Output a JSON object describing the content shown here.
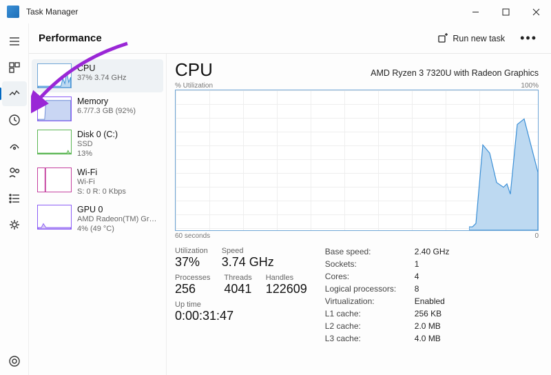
{
  "app": {
    "title": "Task Manager"
  },
  "topbar": {
    "heading": "Performance",
    "run_label": "Run new task"
  },
  "sidepanel": {
    "items": [
      {
        "name": "CPU",
        "sub1": "37%  3.74 GHz",
        "sub2": ""
      },
      {
        "name": "Memory",
        "sub1": "6.7/7.3 GB (92%)",
        "sub2": ""
      },
      {
        "name": "Disk 0 (C:)",
        "sub1": "SSD",
        "sub2": "13%"
      },
      {
        "name": "Wi-Fi",
        "sub1": "Wi-Fi",
        "sub2": "S: 0 R: 0 Kbps"
      },
      {
        "name": "GPU 0",
        "sub1": "AMD Radeon(TM) Gr…",
        "sub2": "4% (49 °C)"
      }
    ]
  },
  "detail": {
    "title": "CPU",
    "model": "AMD Ryzen 3 7320U with Radeon Graphics",
    "axis_top_left": "% Utilization",
    "axis_top_right": "100%",
    "axis_bot_left": "60 seconds",
    "axis_bot_right": "0",
    "stats": {
      "utilization_label": "Utilization",
      "utilization": "37%",
      "speed_label": "Speed",
      "speed": "3.74 GHz",
      "processes_label": "Processes",
      "processes": "256",
      "threads_label": "Threads",
      "threads": "4041",
      "handles_label": "Handles",
      "handles": "122609",
      "uptime_label": "Up time",
      "uptime": "0:00:31:47"
    },
    "kv": {
      "base_speed_k": "Base speed:",
      "base_speed_v": "2.40 GHz",
      "sockets_k": "Sockets:",
      "sockets_v": "1",
      "cores_k": "Cores:",
      "cores_v": "4",
      "lprocs_k": "Logical processors:",
      "lprocs_v": "8",
      "virt_k": "Virtualization:",
      "virt_v": "Enabled",
      "l1_k": "L1 cache:",
      "l1_v": "256 KB",
      "l2_k": "L2 cache:",
      "l2_v": "2.0 MB",
      "l3_k": "L3 cache:",
      "l3_v": "4.0 MB"
    }
  },
  "chart_data": {
    "type": "area",
    "title": "CPU % Utilization",
    "xlabel": "seconds",
    "ylabel": "% Utilization",
    "xlim": [
      60,
      0
    ],
    "ylim": [
      0,
      100
    ],
    "x": [
      60,
      10,
      9,
      8,
      7,
      6,
      5,
      4,
      3,
      2,
      1,
      0
    ],
    "values": [
      2,
      2,
      5,
      60,
      55,
      35,
      30,
      32,
      25,
      75,
      80,
      40
    ]
  }
}
